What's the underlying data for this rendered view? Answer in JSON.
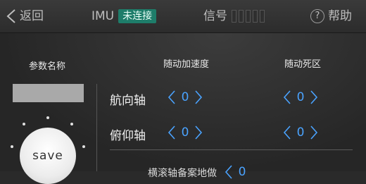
{
  "topbar": {
    "back_label": "返回",
    "imu_label": "IMU",
    "imu_status": "未连接",
    "signal_label": "信号",
    "help_label": "帮助",
    "help_glyph": "?"
  },
  "headers": {
    "param_name": "参数名称",
    "follow_accel": "随动加速度",
    "follow_deadzone": "随动死区"
  },
  "rows": [
    {
      "label": "航向轴",
      "accel": "0",
      "deadzone": "0"
    },
    {
      "label": "俯仰轴",
      "accel": "0",
      "deadzone": "0"
    }
  ],
  "partial_row": {
    "label": "横滚轴备案地做",
    "value": "0"
  },
  "save_label": "save",
  "colors": {
    "accent": "#4aa3ff",
    "status_bg": "#1e7d6a"
  },
  "icons": [
    "back-chevron-icon",
    "help-circle-icon",
    "left-arrow-icon",
    "right-arrow-icon"
  ]
}
